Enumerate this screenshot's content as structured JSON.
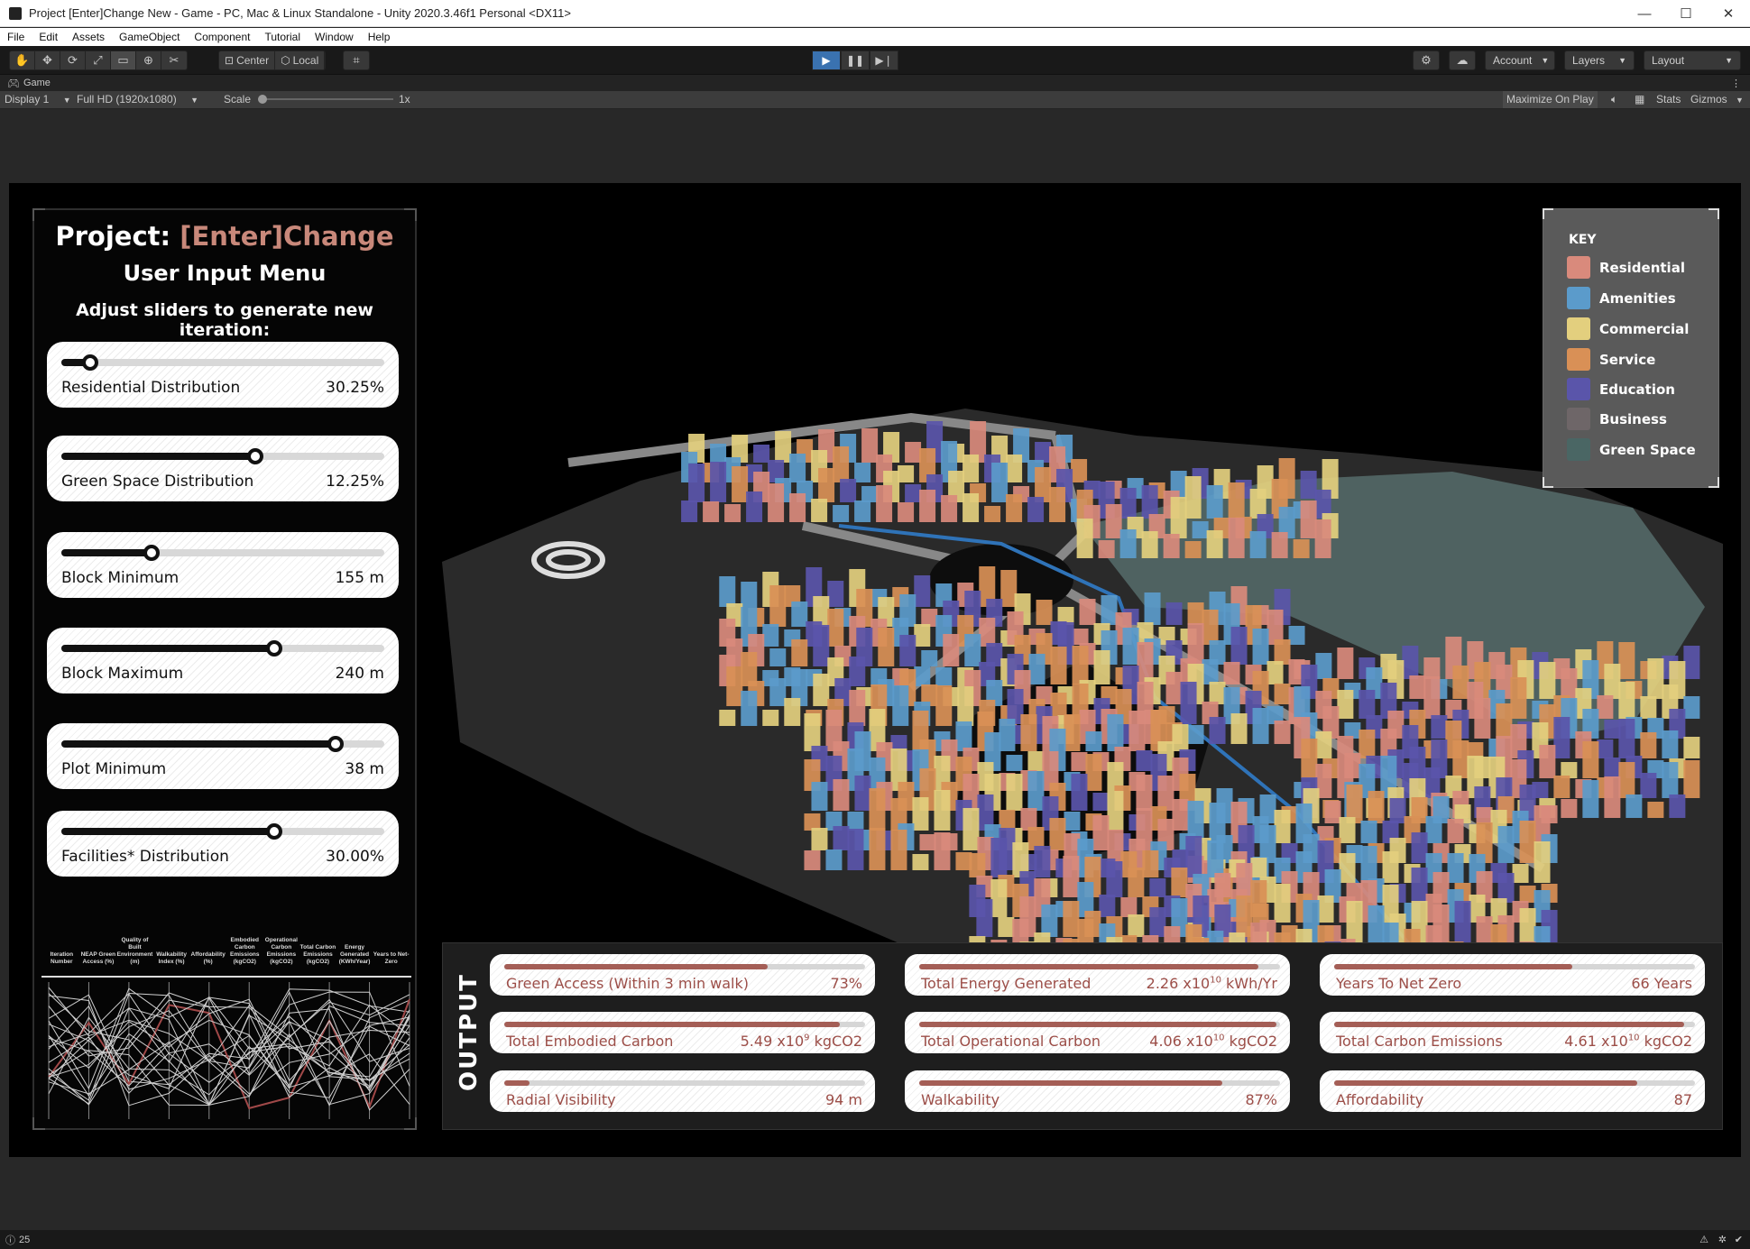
{
  "window": {
    "title": "Project [Enter]Change New - Game - PC, Mac & Linux Standalone - Unity 2020.3.46f1 Personal <DX11>",
    "minimize": "—",
    "maximize": "☐",
    "close": "✕"
  },
  "menu": [
    "File",
    "Edit",
    "Assets",
    "GameObject",
    "Component",
    "Tutorial",
    "Window",
    "Help"
  ],
  "toolbar": {
    "pivot_label": "Center",
    "space_label": "Local",
    "account_label": "Account",
    "layers_label": "Layers",
    "layout_label": "Layout"
  },
  "game_tab": {
    "label": "Game",
    "display": "Display 1",
    "resolution": "Full HD (1920x1080)",
    "scale_label": "Scale",
    "scale_value": "1x",
    "maximize_on_play": "Maximize On Play",
    "stats": "Stats",
    "gizmos": "Gizmos"
  },
  "status": {
    "count": "25"
  },
  "panel": {
    "title_prefix": "Project:",
    "title_accent": "[Enter]Change",
    "subtitle": "User Input Menu",
    "instruction": "Adjust sliders to generate new iteration:",
    "sliders": [
      {
        "label": "Residential Distribution",
        "value": "30.25%",
        "fraction": 0.09
      },
      {
        "label": "Green Space Distribution",
        "value": "12.25%",
        "fraction": 0.6
      },
      {
        "label": "Block Minimum",
        "value": "155 m",
        "fraction": 0.28
      },
      {
        "label": "Block Maximum",
        "value": "240 m",
        "fraction": 0.66
      },
      {
        "label": "Plot Minimum",
        "value": "38 m",
        "fraction": 0.85
      },
      {
        "label": "Facilities* Distribution",
        "value": "30.00%",
        "fraction": 0.66
      }
    ],
    "pc_headers": [
      "Iteration Number",
      "NEAP Green Access (%)",
      "Quality of Built Environment (m)",
      "Walkability Index (%)",
      "Affordability (%)",
      "Embodied Carbon Emissions (kgCO2)",
      "Operational Carbon Emissions (kgCO2)",
      "Total Carbon Emissions (kgCO2)",
      "Energy Generated (KWh/Year)",
      "Years to Net-Zero"
    ]
  },
  "key": {
    "title": "KEY",
    "items": [
      {
        "label": "Residential",
        "color": "#d98a7c"
      },
      {
        "label": "Amenities",
        "color": "#5b9bcb"
      },
      {
        "label": "Commercial",
        "color": "#e3cf7e"
      },
      {
        "label": "Service",
        "color": "#d99056"
      },
      {
        "label": "Education",
        "color": "#5a55aa"
      },
      {
        "label": "Business",
        "color": "#6e6668"
      },
      {
        "label": "Green Space",
        "color": "#4a6664"
      }
    ]
  },
  "output": {
    "label": "OUTPUT",
    "cards": [
      {
        "label": "Green Access (Within 3 min walk)",
        "value": "73%",
        "fraction": 0.73
      },
      {
        "label": "Total Energy Generated",
        "value": "2.26 x10",
        "exp": "10",
        "unit": " kWh/Yr",
        "fraction": 0.94
      },
      {
        "label": "Years To Net Zero",
        "value": "66 Years",
        "fraction": 0.66
      },
      {
        "label": "Total Embodied Carbon",
        "value": "5.49 x10",
        "exp": "9",
        "unit": " kgCO2",
        "fraction": 0.93
      },
      {
        "label": "Total Operational Carbon",
        "value": "4.06 x10",
        "exp": "10",
        "unit": " kgCO2",
        "fraction": 0.99
      },
      {
        "label": "Total Carbon Emissions",
        "value": "4.61 x10",
        "exp": "10",
        "unit": " kgCO2",
        "fraction": 0.97
      },
      {
        "label": "Radial Visibility",
        "value": "94 m",
        "fraction": 0.07
      },
      {
        "label": "Walkability",
        "value": "87%",
        "fraction": 0.84
      },
      {
        "label": "Affordability",
        "value": "87",
        "fraction": 0.84
      }
    ]
  },
  "colors": {
    "accent": "#c8887a",
    "output_text": "#9c4e48",
    "output_fill": "#a45e56",
    "play_active": "#3a72b0"
  }
}
